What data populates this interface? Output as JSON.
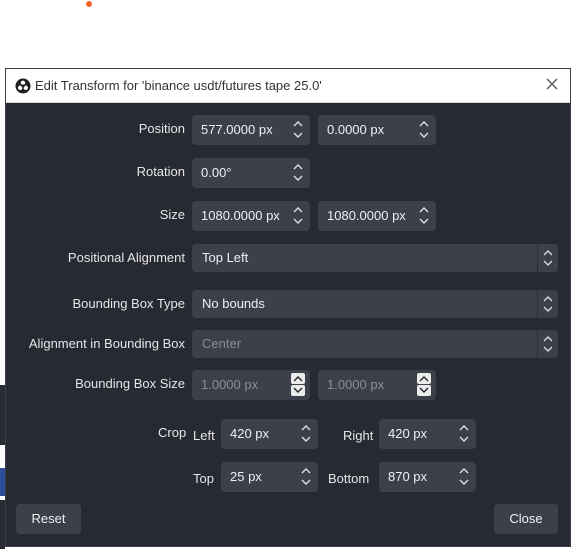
{
  "title": "Edit Transform for 'binance usdt/futures tape 25.0'",
  "position": {
    "label": "Position",
    "x": "577.0000 px",
    "y": "0.0000 px"
  },
  "rotation": {
    "label": "Rotation",
    "value": "0.00°"
  },
  "size": {
    "label": "Size",
    "width": "1080.0000 px",
    "height": "1080.0000 px"
  },
  "positional_alignment": {
    "label": "Positional Alignment",
    "value": "Top Left"
  },
  "bounding_box_type": {
    "label": "Bounding Box Type",
    "value": "No bounds"
  },
  "alignment_in_bounding_box": {
    "label": "Alignment in Bounding Box",
    "value": "Center"
  },
  "bounding_box_size": {
    "label": "Bounding Box Size",
    "width": "1.0000 px",
    "height": "1.0000 px"
  },
  "crop": {
    "label": "Crop",
    "left_label": "Left",
    "left": "420 px",
    "right_label": "Right",
    "right": "420 px",
    "top_label": "Top",
    "top": "25 px",
    "bottom_label": "Bottom",
    "bottom": "870 px"
  },
  "buttons": {
    "reset": "Reset",
    "close": "Close"
  },
  "colors": {
    "accent_dot": "#f0662a",
    "dialog_bg": "#272a33",
    "field_bg": "#3c404b"
  },
  "icons": {
    "app": "obs-logo-icon",
    "close": "close-icon"
  }
}
